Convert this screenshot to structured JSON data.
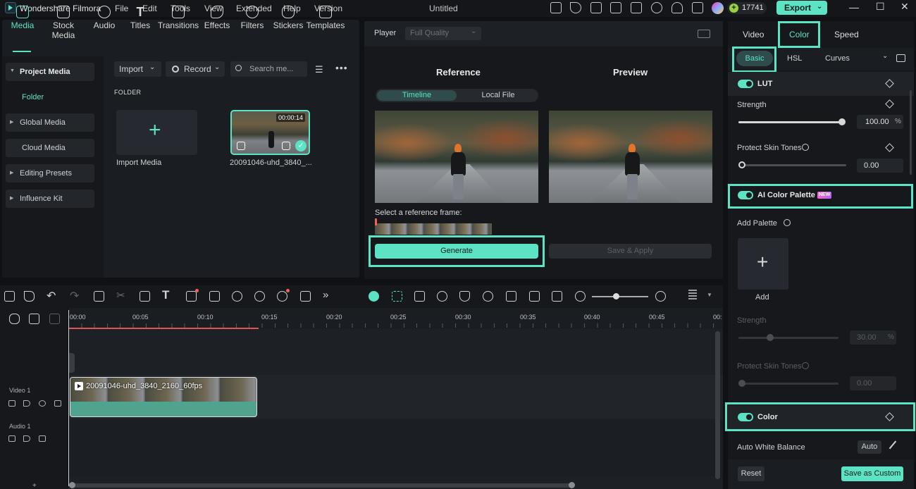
{
  "titlebar": {
    "app_name": "Wondershare Filmora",
    "menus": [
      "File",
      "Edit",
      "Tools",
      "View",
      "Extended",
      "Help",
      "Version"
    ],
    "doc_title": "Untitled",
    "credits": "17741",
    "export_label": "Export"
  },
  "media_tabs": [
    {
      "label": "Media",
      "icon": "media-icon",
      "active": true
    },
    {
      "label": "Stock Media",
      "icon": "stock-media-icon"
    },
    {
      "label": "Audio",
      "icon": "music-note-icon"
    },
    {
      "label": "Titles",
      "icon": "title-t-icon"
    },
    {
      "label": "Transitions",
      "icon": "transitions-icon"
    },
    {
      "label": "Effects",
      "icon": "effects-icon"
    },
    {
      "label": "Filters",
      "icon": "filters-icon"
    },
    {
      "label": "Stickers",
      "icon": "stickers-icon"
    },
    {
      "label": "Templates",
      "icon": "templates-icon"
    }
  ],
  "sidebar": {
    "items": [
      "Project Media",
      "Folder",
      "Global Media",
      "Cloud Media",
      "Editing Presets",
      "Influence Kit"
    ]
  },
  "media_toolbar": {
    "import_label": "Import",
    "record_label": "Record",
    "search_placeholder": "Search me..."
  },
  "folder_header": "FOLDER",
  "media_items": {
    "import_label": "Import Media",
    "clip_label": "20091046-uhd_3840_...",
    "clip_duration": "00:00:14"
  },
  "player": {
    "label": "Player",
    "quality": "Full Quality",
    "reference_title": "Reference",
    "preview_title": "Preview",
    "seg_timeline": "Timeline",
    "seg_local_file": "Local File",
    "select_ref_label": "Select a reference frame:",
    "generate_label": "Generate",
    "save_apply_label": "Save & Apply"
  },
  "right_panel": {
    "tabs": [
      "Video",
      "Color",
      "Speed"
    ],
    "subtabs": [
      "Basic",
      "HSL",
      "Curves"
    ],
    "lut_title": "LUT",
    "strength_label": "Strength",
    "strength_value": "100.00",
    "strength_fraction": 1.0,
    "protect_label": "Protect Skin Tones",
    "protect_value": "0.00",
    "ai_palette_title": "AI Color Palette",
    "new_badge": "NEW",
    "add_palette_label": "Add Palette",
    "add_label": "Add",
    "ai_strength_label": "Strength",
    "ai_strength_value": "30.00",
    "ai_protect_label": "Protect Skin Tones",
    "ai_protect_value": "0.00",
    "color_title": "Color",
    "awb_label": "Auto White Balance",
    "auto_label": "Auto",
    "reset_label": "Reset",
    "save_custom_label": "Save as Custom",
    "percent": "%"
  },
  "timeline": {
    "ticks": [
      "00:00",
      "00:05",
      "00:10",
      "00:15",
      "00:20",
      "00:25",
      "00:30",
      "00:35",
      "00:40",
      "00:45",
      "00:"
    ],
    "video_track_label": "Video 1",
    "audio_track_label": "Audio 1",
    "clip_name": "20091046-uhd_3840_2160_60fps"
  },
  "accent_color": "#5be3c4"
}
